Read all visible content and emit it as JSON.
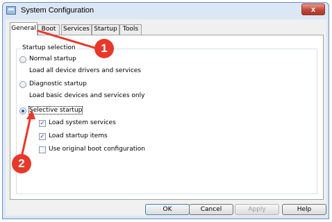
{
  "window": {
    "title": "System Configuration",
    "close_label": "x"
  },
  "tabs": [
    {
      "label": "General",
      "active": true
    },
    {
      "label": "Boot"
    },
    {
      "label": "Services"
    },
    {
      "label": "Startup"
    },
    {
      "label": "Tools"
    }
  ],
  "startup_selection": {
    "group_label": "Startup selection",
    "selected": "selective",
    "normal": {
      "label": "Normal startup",
      "description": "Load all device drivers and services"
    },
    "diagnostic": {
      "label": "Diagnostic startup",
      "description": "Load basic devices and services only"
    },
    "selective": {
      "label": "Selective startup",
      "options": [
        {
          "label": "Load system services",
          "checked": true
        },
        {
          "label": "Load startup items",
          "checked": true
        },
        {
          "label": "Use original boot configuration",
          "checked": false
        }
      ]
    }
  },
  "buttons": {
    "ok": "OK",
    "cancel": "Cancel",
    "apply": "Apply",
    "help": "Help"
  },
  "annotations": {
    "marker_1": "1",
    "marker_2": "2",
    "color": "#e8382a"
  }
}
